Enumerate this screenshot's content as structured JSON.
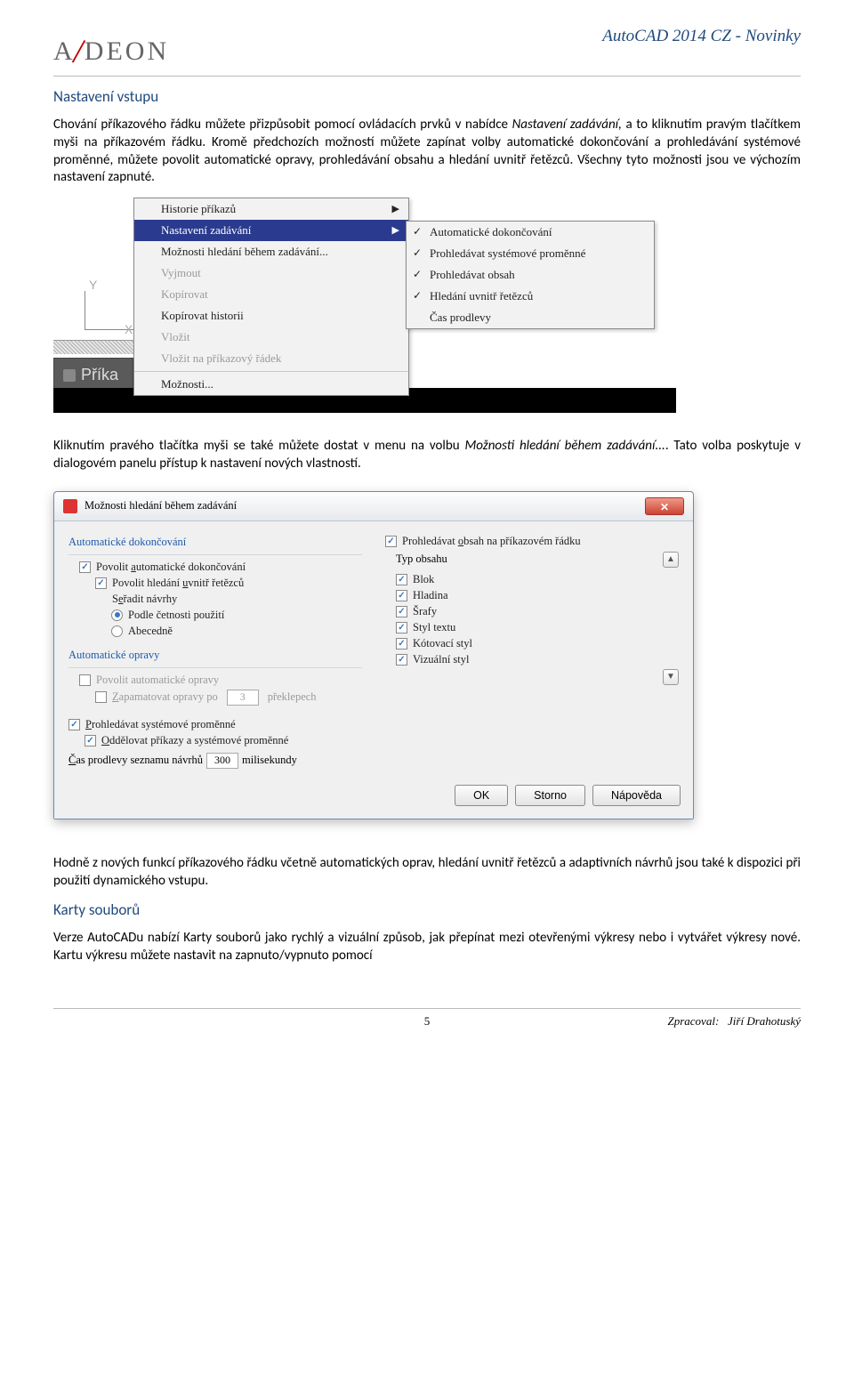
{
  "header": {
    "logo_left": "A",
    "logo_right": "DEON",
    "doc_title": "AutoCAD 2014 CZ - Novinky"
  },
  "section1": {
    "title": "Nastavení vstupu",
    "p1_a": "Chování příkazového řádku můžete přizpůsobit pomocí ovládacích prvků v nabídce ",
    "p1_i": "Nastavení zadávání,",
    "p1_b": " a to kliknutím pravým tlačítkem myši na příkazovém řádku. Kromě předchozích možností můžete zapínat volby automatické dokončování a prohledávání systémové proměnné, můžete povolit automatické opravy, prohledávání obsahu a hledání uvnitř řetězců. Všechny tyto možnosti jsou ve výchozím nastavení zapnuté."
  },
  "ctx_menu": {
    "axis_y": "Y",
    "axis_x": "X",
    "cmd_prompt": "Příka",
    "items1": [
      {
        "label": "Historie příkazů",
        "arrow": true
      },
      {
        "label": "Nastavení zadávání",
        "arrow": true,
        "selected": true
      },
      {
        "label": "Možnosti hledání během zadávání..."
      },
      {
        "label": "Vyjmout",
        "disabled": true
      },
      {
        "label": "Kopírovat",
        "disabled": true
      },
      {
        "label": "Kopírovat historii"
      },
      {
        "label": "Vložit",
        "disabled": true
      },
      {
        "label": "Vložit na příkazový řádek",
        "disabled": true
      },
      {
        "sep": true
      },
      {
        "label": "Možnosti..."
      }
    ],
    "items2": [
      {
        "label": "Automatické dokončování",
        "checked": true
      },
      {
        "label": "Prohledávat systémové proměnné",
        "checked": true
      },
      {
        "label": "Prohledávat obsah",
        "checked": true
      },
      {
        "label": "Hledání uvnitř řetězců",
        "checked": true
      },
      {
        "label": "Čas prodlevy",
        "checked": false
      }
    ]
  },
  "para2_a": "Kliknutím pravého tlačítka myši se také můžete dostat v menu na volbu ",
  "para2_i": "Možnosti hledání během zadávání...",
  "para2_b": ". Tato volba poskytuje v dialogovém panelu přístup k nastavení nových vlastností.",
  "dialog": {
    "title": "Možnosti hledání během zadávání",
    "left": {
      "grp1": "Automatické dokončování",
      "ck1": "Povolit automatické dokončování",
      "ck2": "Povolit hledání uvnitř řetězců",
      "sort_label": "Seřadit návrhy",
      "rd1": "Podle četnosti použití",
      "rd2": "Abecedně",
      "grp2": "Automatické opravy",
      "ck3": "Povolit automatické opravy",
      "ck4_a": "Zapamatovat opravy po",
      "ck4_val": "3",
      "ck4_b": "překlepech",
      "ck5": "Prohledávat systémové proměnné",
      "ck6": "Oddělovat příkazy a systémové proměnné",
      "delay_a": "Čas prodlevy seznamu návrhů",
      "delay_val": "300",
      "delay_b": "milisekundy"
    },
    "right": {
      "ck1": "Prohledávat obsah na příkazovém řádku",
      "type_label": "Typ obsahu",
      "items": [
        "Blok",
        "Hladina",
        "Šrafy",
        "Styl textu",
        "Kótovací styl",
        "Vizuální styl"
      ]
    },
    "btn_ok": "OK",
    "btn_cancel": "Storno",
    "btn_help": "Nápověda"
  },
  "para3": "Hodně z nových funkcí příkazového řádku včetně automatických oprav, hledání uvnitř řetězců a adaptivních návrhů jsou také k dispozici při použití dynamického vstupu.",
  "section2_title": "Karty souborů",
  "para4": "Verze AutoCADu nabízí Karty souborů jako rychlý a vizuální způsob, jak přepínat mezi otevřenými výkresy nebo i vytvářet výkresy nové. Kartu výkresu můžete nastavit na zapnuto/vypnuto pomocí",
  "footer": {
    "page": "5",
    "right_a": "Zpracoval:",
    "right_b": "Jiří Drahotuský"
  }
}
